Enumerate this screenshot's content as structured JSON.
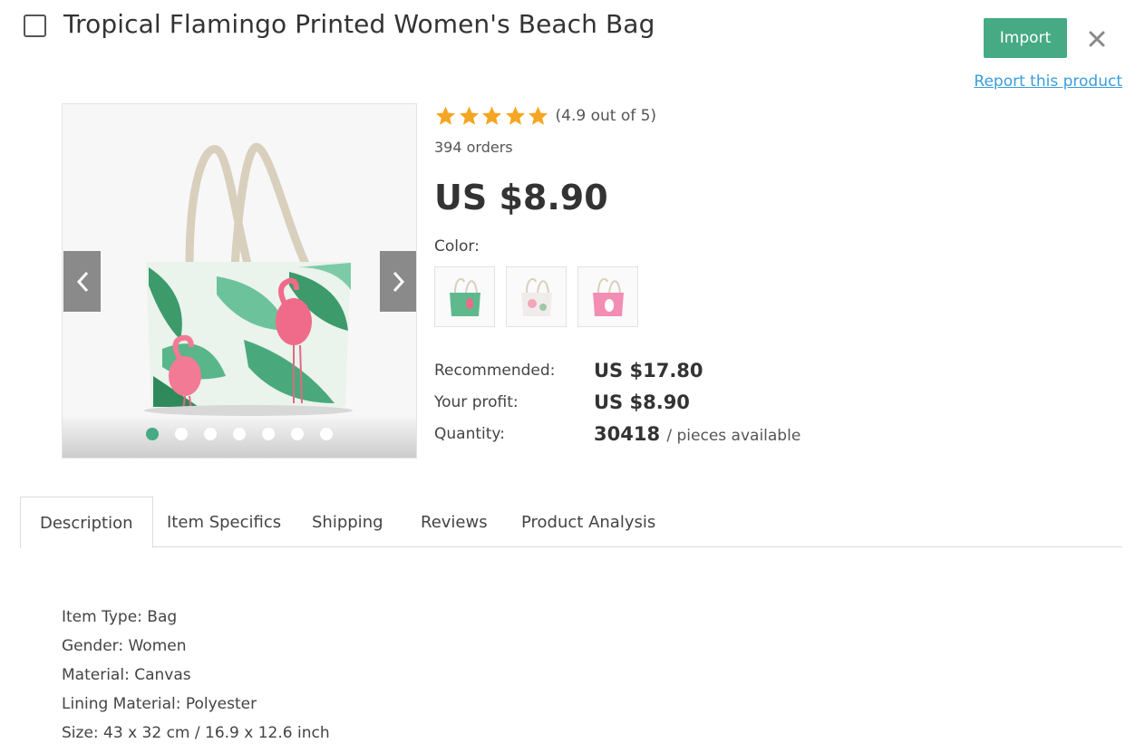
{
  "product": {
    "title": "Tropical Flamingo Printed Women's Beach Bag",
    "rating": 4.9,
    "rating_max": 5,
    "rating_text": "(4.9 out of 5)",
    "orders": "394 orders",
    "price": "US $8.90"
  },
  "actions": {
    "import_label": "Import",
    "report_label": "Report this product"
  },
  "gallery": {
    "image_count": 7,
    "active_index": 0
  },
  "color": {
    "label": "Color:",
    "options": [
      "green-leaf",
      "white-floral",
      "pink"
    ]
  },
  "info": {
    "recommended_label": "Recommended:",
    "recommended_value": "US $17.80",
    "profit_label": "Your profit:",
    "profit_value": "US $8.90",
    "quantity_label": "Quantity:",
    "quantity_value": "30418",
    "quantity_suffix": "/ pieces available"
  },
  "tabs": [
    {
      "label": "Description",
      "active": true
    },
    {
      "label": "Item Specifics",
      "active": false
    },
    {
      "label": "Shipping",
      "active": false
    },
    {
      "label": "Reviews",
      "active": false
    },
    {
      "label": "Product Analysis",
      "active": false
    }
  ],
  "description": [
    "Item Type: Bag",
    "Gender: Women",
    "Material: Canvas",
    "Lining Material: Polyester",
    "Size: 43 x 32 cm / 16.9 x 12.6 inch"
  ],
  "colors": {
    "accent": "#46aa85",
    "link": "#3a9ddb",
    "star": "#f5a623"
  }
}
